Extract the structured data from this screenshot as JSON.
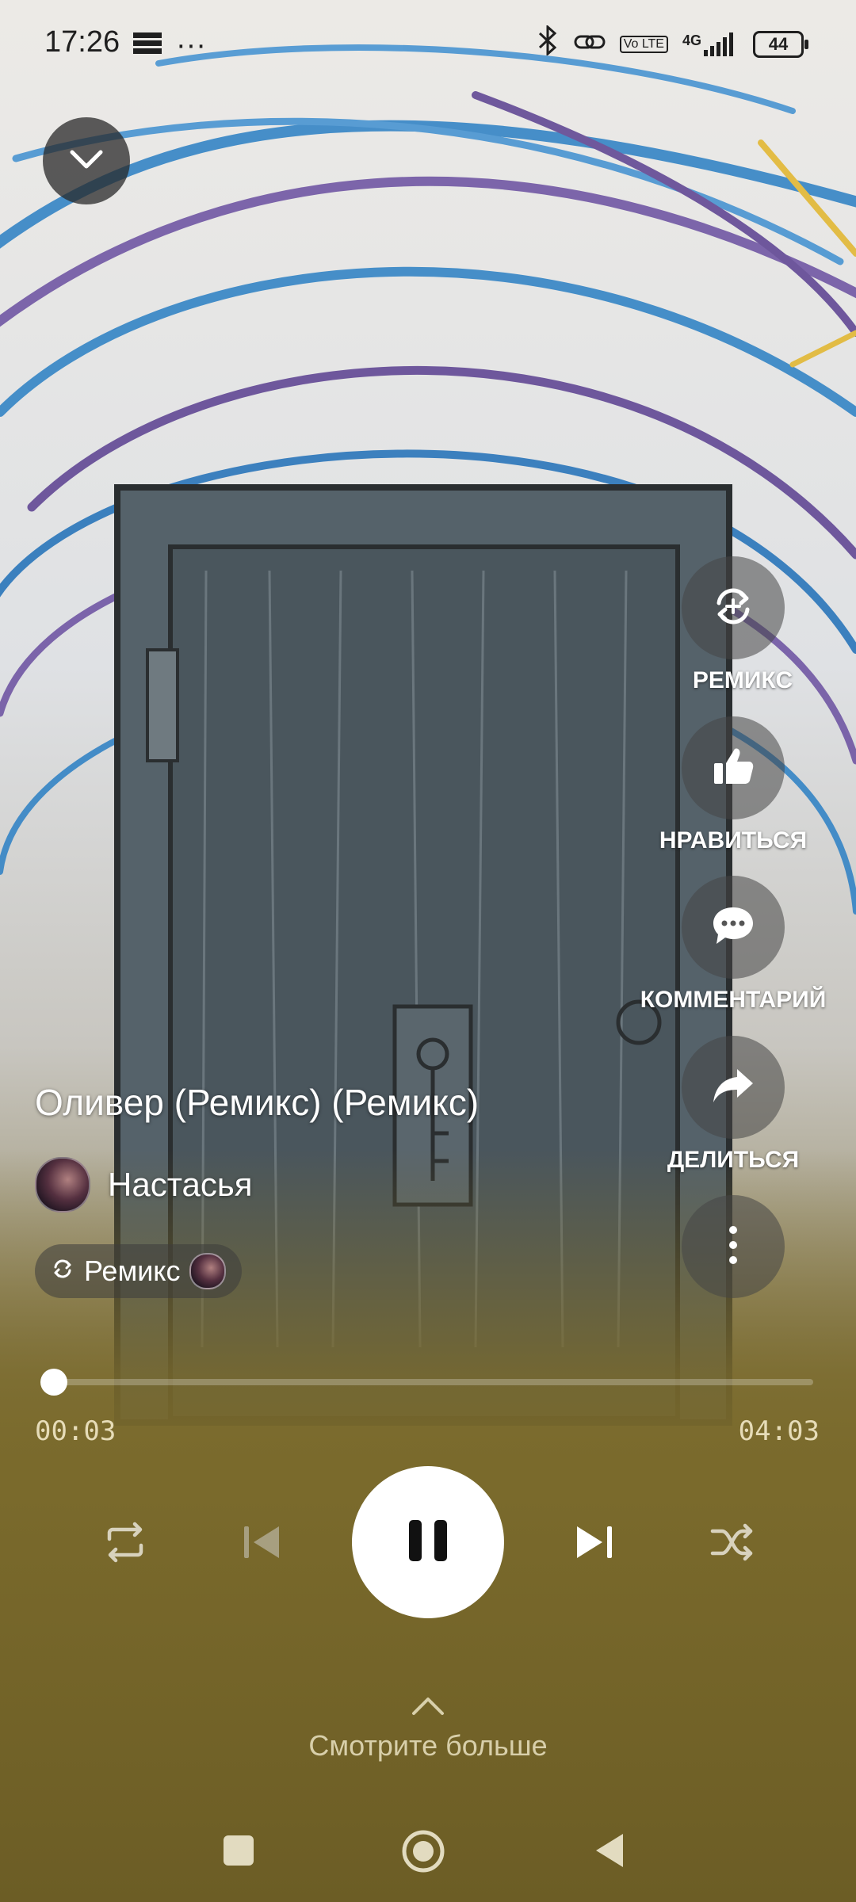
{
  "status_bar": {
    "time": "17:26",
    "more": "···",
    "battery": "44",
    "network": "4G",
    "volte": "Vo LTE"
  },
  "track": {
    "title": "Оливер (Ремикс) (Ремикс)",
    "artist": "Настасья",
    "remix_chip_label": "Ремикс"
  },
  "actions": {
    "remix": "РЕМИКС",
    "like": "НРАВИТЬСЯ",
    "comment": "КОММЕНТАРИЙ",
    "share": "ДЕЛИТЬСЯ"
  },
  "player": {
    "elapsed": "00:03",
    "total": "04:03",
    "progress_fraction": 0.012
  },
  "see_more": {
    "label": "Смотрите больше"
  },
  "colors": {
    "accent_bg": "#7a6a2c",
    "text_primary": "#ffffff"
  },
  "icons": [
    "collapse-chevron-icon",
    "remix-icon",
    "thumbs-up-icon",
    "comment-icon",
    "share-icon",
    "more-vertical-icon",
    "repeat-icon",
    "previous-icon",
    "pause-icon",
    "next-icon",
    "shuffle-icon",
    "chevron-up-icon",
    "home-square-icon",
    "home-circle-icon",
    "back-triangle-icon"
  ]
}
